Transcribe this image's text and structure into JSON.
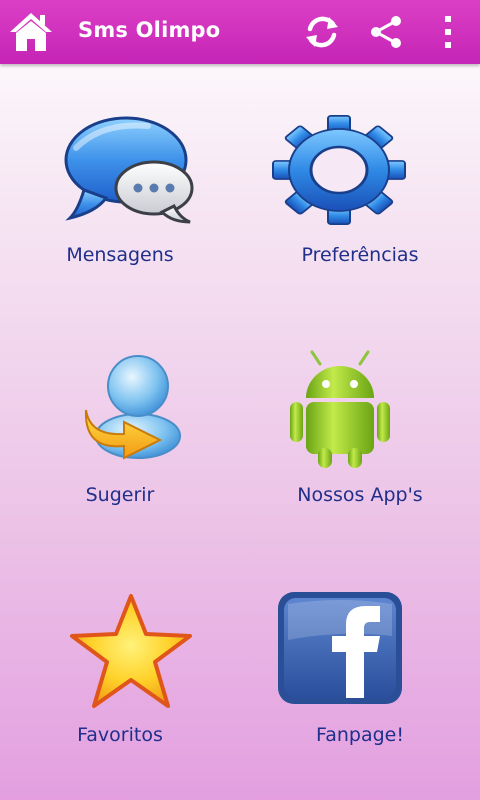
{
  "app_bar": {
    "title": "Sms Olimpo",
    "icons": [
      "home-icon",
      "refresh-icon",
      "share-icon",
      "overflow-menu-icon"
    ],
    "background": "#d132bf"
  },
  "menu": {
    "items": [
      {
        "label": "Mensagens",
        "icon": "chat-bubbles-icon"
      },
      {
        "label": "Preferências",
        "icon": "gear-icon"
      },
      {
        "label": "Sugerir",
        "icon": "user-arrow-icon"
      },
      {
        "label": "Nossos App's",
        "icon": "android-icon"
      },
      {
        "label": "Favoritos",
        "icon": "star-icon"
      },
      {
        "label": "Fanpage!",
        "icon": "facebook-icon"
      }
    ]
  },
  "colors": {
    "label_text": "#1f2f8a",
    "background_top": "#ffffff",
    "background_bottom": "#e39fe0"
  }
}
